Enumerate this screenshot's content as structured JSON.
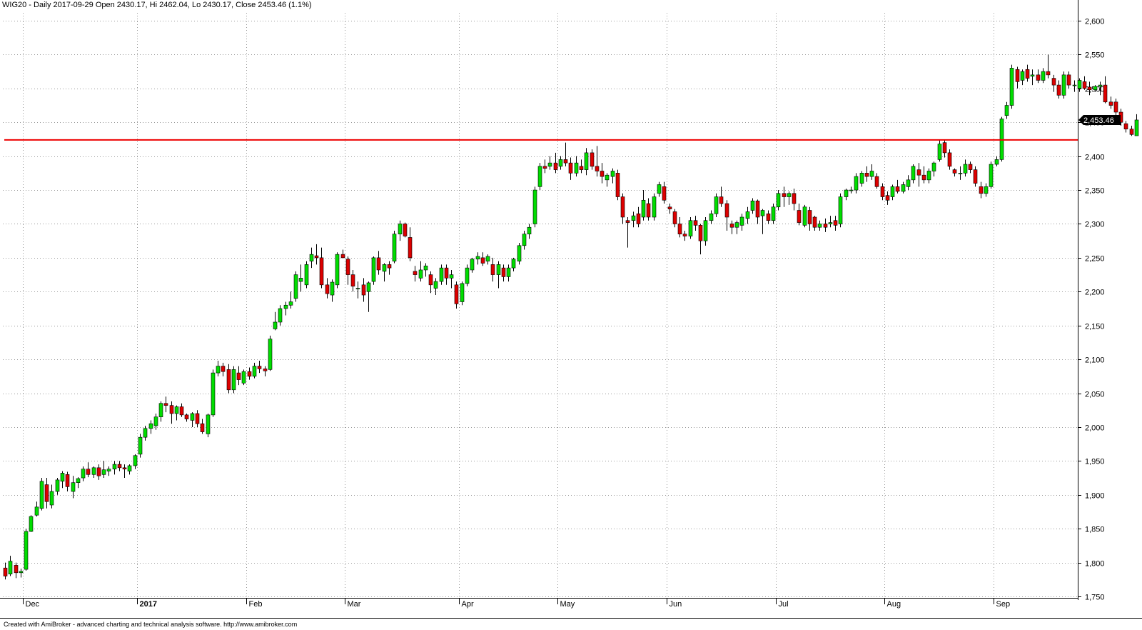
{
  "title_text": "WIG20 - Daily 2017-09-29 Open 2430.17, Hi 2462.04, Lo 2430.17, Close 2453.46 (1.1%)",
  "footer_text": "Created with AmiBroker - advanced charting and technical analysis software. http://www.amibroker.com",
  "colors": {
    "up": "#00dd00",
    "down": "#dd0000",
    "wick": "#000000",
    "grid": "#999999",
    "resistance": "#ee0000",
    "price_tag_bg": "#000000"
  },
  "chart_data": {
    "type": "candlestick",
    "symbol": "WIG20",
    "interval": "Daily",
    "ylim": [
      1750,
      2600
    ],
    "yticks": [
      1750,
      1800,
      1850,
      1900,
      1950,
      2000,
      2050,
      2100,
      2150,
      2200,
      2250,
      2300,
      2350,
      2400,
      2450,
      2500,
      2550,
      2600
    ],
    "ytick_labels": [
      "1,750",
      "1,800",
      "1,850",
      "1,900",
      "1,950",
      "2,000",
      "2,050",
      "2,100",
      "2,150",
      "2,200",
      "2,250",
      "2,300",
      "2,350",
      "2,400",
      "2,450",
      "2,500",
      "2,550",
      "2,600"
    ],
    "grid": "horizontal dotted",
    "last_price": 2453.46,
    "last_price_label": "2,453.46",
    "resistance_level": 2424,
    "x_labels": [
      {
        "label": "Dec",
        "bar": 4,
        "bold": false
      },
      {
        "label": "2017",
        "bar": 26,
        "bold": true
      },
      {
        "label": "Feb",
        "bar": 47,
        "bold": false
      },
      {
        "label": "Mar",
        "bar": 66,
        "bold": false
      },
      {
        "label": "Apr",
        "bar": 88,
        "bold": false
      },
      {
        "label": "May",
        "bar": 107,
        "bold": false
      },
      {
        "label": "Jun",
        "bar": 128,
        "bold": false
      },
      {
        "label": "Jul",
        "bar": 149,
        "bold": false
      },
      {
        "label": "Aug",
        "bar": 170,
        "bold": false
      },
      {
        "label": "Sep",
        "bar": 191,
        "bold": false
      }
    ],
    "ohlc": [
      [
        1792,
        1800,
        1775,
        1780
      ],
      [
        1783,
        1810,
        1780,
        1802
      ],
      [
        1796,
        1800,
        1777,
        1785
      ],
      [
        1785,
        1791,
        1778,
        1787
      ],
      [
        1790,
        1850,
        1788,
        1846
      ],
      [
        1846,
        1870,
        1845,
        1868
      ],
      [
        1870,
        1890,
        1868,
        1882
      ],
      [
        1880,
        1925,
        1877,
        1920
      ],
      [
        1915,
        1925,
        1880,
        1890
      ],
      [
        1885,
        1915,
        1880,
        1905
      ],
      [
        1905,
        1925,
        1900,
        1922
      ],
      [
        1920,
        1935,
        1910,
        1932
      ],
      [
        1930,
        1934,
        1905,
        1912
      ],
      [
        1905,
        1928,
        1895,
        1918
      ],
      [
        1918,
        1926,
        1910,
        1924
      ],
      [
        1925,
        1942,
        1920,
        1938
      ],
      [
        1938,
        1948,
        1926,
        1930
      ],
      [
        1930,
        1942,
        1925,
        1940
      ],
      [
        1940,
        1945,
        1922,
        1928
      ],
      [
        1930,
        1950,
        1925,
        1937
      ],
      [
        1935,
        1942,
        1928,
        1938
      ],
      [
        1938,
        1950,
        1930,
        1945
      ],
      [
        1945,
        1950,
        1935,
        1940
      ],
      [
        1940,
        1945,
        1925,
        1938
      ],
      [
        1935,
        1945,
        1930,
        1943
      ],
      [
        1943,
        1960,
        1938,
        1958
      ],
      [
        1960,
        1990,
        1955,
        1985
      ],
      [
        1985,
        2002,
        1980,
        1998
      ],
      [
        1998,
        2010,
        1990,
        2005
      ],
      [
        2002,
        2020,
        1996,
        2015
      ],
      [
        2015,
        2038,
        2008,
        2035
      ],
      [
        2035,
        2045,
        2022,
        2032
      ],
      [
        2032,
        2038,
        2005,
        2020
      ],
      [
        2020,
        2032,
        2010,
        2030
      ],
      [
        2030,
        2035,
        2015,
        2018
      ],
      [
        2018,
        2020,
        2008,
        2012
      ],
      [
        2010,
        2022,
        2000,
        2020
      ],
      [
        2020,
        2025,
        2000,
        2005
      ],
      [
        2005,
        2012,
        1990,
        1993
      ],
      [
        1990,
        2020,
        1985,
        2018
      ],
      [
        2018,
        2085,
        2015,
        2080
      ],
      [
        2080,
        2098,
        2075,
        2090
      ],
      [
        2090,
        2095,
        2075,
        2082
      ],
      [
        2085,
        2093,
        2050,
        2055
      ],
      [
        2055,
        2090,
        2050,
        2085
      ],
      [
        2080,
        2090,
        2062,
        2070
      ],
      [
        2065,
        2085,
        2062,
        2082
      ],
      [
        2082,
        2088,
        2070,
        2075
      ],
      [
        2075,
        2095,
        2072,
        2090
      ],
      [
        2090,
        2098,
        2080,
        2086
      ],
      [
        2086,
        2090,
        2075,
        2083
      ],
      [
        2085,
        2135,
        2083,
        2130
      ],
      [
        2145,
        2170,
        2143,
        2155
      ],
      [
        2155,
        2180,
        2150,
        2175
      ],
      [
        2175,
        2185,
        2165,
        2180
      ],
      [
        2180,
        2200,
        2175,
        2185
      ],
      [
        2190,
        2230,
        2185,
        2225
      ],
      [
        2215,
        2240,
        2200,
        2220
      ],
      [
        2210,
        2245,
        2205,
        2240
      ],
      [
        2245,
        2265,
        2235,
        2255
      ],
      [
        2253,
        2270,
        2240,
        2250
      ],
      [
        2250,
        2265,
        2205,
        2210
      ],
      [
        2210,
        2220,
        2190,
        2197
      ],
      [
        2195,
        2218,
        2185,
        2214
      ],
      [
        2210,
        2258,
        2205,
        2255
      ],
      [
        2255,
        2262,
        2250,
        2250
      ],
      [
        2248,
        2252,
        2210,
        2225
      ],
      [
        2225,
        2232,
        2200,
        2208
      ],
      [
        2205,
        2215,
        2190,
        2205
      ],
      [
        2210,
        2220,
        2185,
        2195
      ],
      [
        2200,
        2215,
        2170,
        2213
      ],
      [
        2215,
        2252,
        2210,
        2250
      ],
      [
        2250,
        2260,
        2225,
        2232
      ],
      [
        2230,
        2242,
        2215,
        2240
      ],
      [
        2240,
        2245,
        2225,
        2235
      ],
      [
        2245,
        2290,
        2242,
        2285
      ],
      [
        2285,
        2305,
        2275,
        2300
      ],
      [
        2300,
        2302,
        2280,
        2282
      ],
      [
        2280,
        2295,
        2245,
        2250
      ],
      [
        2230,
        2238,
        2215,
        2225
      ],
      [
        2220,
        2245,
        2215,
        2232
      ],
      [
        2232,
        2242,
        2222,
        2238
      ],
      [
        2225,
        2230,
        2198,
        2210
      ],
      [
        2205,
        2220,
        2195,
        2215
      ],
      [
        2215,
        2240,
        2210,
        2235
      ],
      [
        2235,
        2240,
        2210,
        2220
      ],
      [
        2220,
        2232,
        2205,
        2225
      ],
      [
        2210,
        2215,
        2175,
        2182
      ],
      [
        2185,
        2215,
        2180,
        2212
      ],
      [
        2212,
        2240,
        2208,
        2235
      ],
      [
        2232,
        2250,
        2228,
        2248
      ],
      [
        2248,
        2258,
        2240,
        2252
      ],
      [
        2250,
        2258,
        2238,
        2242
      ],
      [
        2245,
        2255,
        2240,
        2252
      ],
      [
        2240,
        2250,
        2215,
        2225
      ],
      [
        2225,
        2245,
        2205,
        2240
      ],
      [
        2235,
        2240,
        2215,
        2222
      ],
      [
        2222,
        2240,
        2215,
        2235
      ],
      [
        2235,
        2250,
        2230,
        2248
      ],
      [
        2245,
        2272,
        2240,
        2268
      ],
      [
        2268,
        2290,
        2262,
        2285
      ],
      [
        2285,
        2300,
        2278,
        2295
      ],
      [
        2300,
        2355,
        2295,
        2350
      ],
      [
        2355,
        2390,
        2350,
        2385
      ],
      [
        2385,
        2395,
        2375,
        2382
      ],
      [
        2385,
        2400,
        2380,
        2390
      ],
      [
        2390,
        2405,
        2375,
        2380
      ],
      [
        2385,
        2400,
        2380,
        2395
      ],
      [
        2395,
        2420,
        2385,
        2390
      ],
      [
        2390,
        2398,
        2365,
        2375
      ],
      [
        2375,
        2400,
        2370,
        2390
      ],
      [
        2385,
        2395,
        2375,
        2380
      ],
      [
        2380,
        2412,
        2372,
        2405
      ],
      [
        2405,
        2410,
        2380,
        2385
      ],
      [
        2385,
        2415,
        2370,
        2378
      ],
      [
        2378,
        2390,
        2360,
        2370
      ],
      [
        2365,
        2375,
        2355,
        2372
      ],
      [
        2370,
        2382,
        2360,
        2378
      ],
      [
        2375,
        2380,
        2335,
        2340
      ],
      [
        2340,
        2345,
        2300,
        2310
      ],
      [
        2305,
        2310,
        2265,
        2302
      ],
      [
        2305,
        2318,
        2295,
        2312
      ],
      [
        2315,
        2325,
        2295,
        2300
      ],
      [
        2310,
        2350,
        2305,
        2335
      ],
      [
        2330,
        2338,
        2305,
        2310
      ],
      [
        2310,
        2345,
        2305,
        2340
      ],
      [
        2345,
        2362,
        2340,
        2358
      ],
      [
        2355,
        2362,
        2330,
        2335
      ],
      [
        2325,
        2330,
        2315,
        2322
      ],
      [
        2318,
        2322,
        2295,
        2300
      ],
      [
        2300,
        2310,
        2280,
        2285
      ],
      [
        2285,
        2290,
        2275,
        2282
      ],
      [
        2282,
        2310,
        2278,
        2305
      ],
      [
        2305,
        2312,
        2290,
        2298
      ],
      [
        2298,
        2300,
        2255,
        2275
      ],
      [
        2275,
        2310,
        2268,
        2305
      ],
      [
        2305,
        2320,
        2300,
        2315
      ],
      [
        2315,
        2345,
        2310,
        2340
      ],
      [
        2340,
        2355,
        2325,
        2330
      ],
      [
        2330,
        2335,
        2290,
        2310
      ],
      [
        2300,
        2305,
        2285,
        2295
      ],
      [
        2295,
        2305,
        2285,
        2302
      ],
      [
        2298,
        2315,
        2290,
        2310
      ],
      [
        2308,
        2325,
        2300,
        2318
      ],
      [
        2320,
        2338,
        2315,
        2334
      ],
      [
        2334,
        2336,
        2300,
        2310
      ],
      [
        2312,
        2322,
        2285,
        2320
      ],
      [
        2315,
        2320,
        2300,
        2305
      ],
      [
        2305,
        2330,
        2300,
        2325
      ],
      [
        2325,
        2350,
        2320,
        2345
      ],
      [
        2345,
        2355,
        2325,
        2340
      ],
      [
        2340,
        2348,
        2328,
        2345
      ],
      [
        2345,
        2352,
        2320,
        2330
      ],
      [
        2320,
        2330,
        2298,
        2302
      ],
      [
        2298,
        2328,
        2295,
        2325
      ],
      [
        2320,
        2325,
        2290,
        2300
      ],
      [
        2310,
        2312,
        2290,
        2295
      ],
      [
        2295,
        2305,
        2290,
        2300
      ],
      [
        2300,
        2308,
        2288,
        2295
      ],
      [
        2300,
        2312,
        2295,
        2302
      ],
      [
        2305,
        2312,
        2290,
        2298
      ],
      [
        2300,
        2345,
        2295,
        2340
      ],
      [
        2340,
        2352,
        2335,
        2350
      ],
      [
        2350,
        2355,
        2345,
        2350
      ],
      [
        2350,
        2375,
        2345,
        2370
      ],
      [
        2360,
        2378,
        2355,
        2375
      ],
      [
        2375,
        2385,
        2362,
        2370
      ],
      [
        2370,
        2388,
        2365,
        2378
      ],
      [
        2370,
        2375,
        2352,
        2355
      ],
      [
        2355,
        2360,
        2335,
        2340
      ],
      [
        2342,
        2348,
        2328,
        2335
      ],
      [
        2340,
        2358,
        2335,
        2355
      ],
      [
        2355,
        2365,
        2345,
        2348
      ],
      [
        2348,
        2362,
        2345,
        2358
      ],
      [
        2355,
        2372,
        2350,
        2365
      ],
      [
        2365,
        2388,
        2360,
        2385
      ],
      [
        2380,
        2390,
        2355,
        2372
      ],
      [
        2372,
        2385,
        2360,
        2365
      ],
      [
        2365,
        2382,
        2360,
        2378
      ],
      [
        2378,
        2392,
        2370,
        2390
      ],
      [
        2395,
        2425,
        2392,
        2418
      ],
      [
        2420,
        2425,
        2398,
        2405
      ],
      [
        2405,
        2410,
        2380,
        2385
      ],
      [
        2380,
        2382,
        2370,
        2375
      ],
      [
        2375,
        2385,
        2365,
        2375
      ],
      [
        2375,
        2395,
        2370,
        2388
      ],
      [
        2388,
        2392,
        2375,
        2380
      ],
      [
        2380,
        2385,
        2355,
        2360
      ],
      [
        2355,
        2362,
        2338,
        2345
      ],
      [
        2345,
        2360,
        2340,
        2355
      ],
      [
        2355,
        2392,
        2352,
        2388
      ],
      [
        2388,
        2400,
        2385,
        2395
      ],
      [
        2395,
        2458,
        2392,
        2455
      ],
      [
        2460,
        2480,
        2455,
        2475
      ],
      [
        2475,
        2535,
        2470,
        2530
      ],
      [
        2528,
        2532,
        2500,
        2510
      ],
      [
        2512,
        2528,
        2505,
        2525
      ],
      [
        2528,
        2535,
        2510,
        2515
      ],
      [
        2518,
        2528,
        2505,
        2520
      ],
      [
        2520,
        2528,
        2508,
        2512
      ],
      [
        2512,
        2530,
        2508,
        2525
      ],
      [
        2525,
        2550,
        2515,
        2520
      ],
      [
        2515,
        2520,
        2495,
        2505
      ],
      [
        2505,
        2512,
        2485,
        2490
      ],
      [
        2490,
        2525,
        2485,
        2520
      ],
      [
        2520,
        2525,
        2500,
        2505
      ],
      [
        2505,
        2512,
        2495,
        2505
      ],
      [
        2500,
        2515,
        2495,
        2512
      ],
      [
        2510,
        2518,
        2498,
        2500
      ],
      [
        2502,
        2510,
        2490,
        2498
      ],
      [
        2498,
        2505,
        2495,
        2503
      ],
      [
        2503,
        2510,
        2490,
        2505
      ],
      [
        2505,
        2518,
        2478,
        2480
      ],
      [
        2480,
        2488,
        2470,
        2475
      ],
      [
        2480,
        2485,
        2460,
        2465
      ],
      [
        2465,
        2470,
        2445,
        2450
      ],
      [
        2448,
        2452,
        2435,
        2440
      ],
      [
        2440,
        2445,
        2430,
        2432
      ],
      [
        2430.17,
        2462.04,
        2430.17,
        2453.46
      ]
    ]
  }
}
